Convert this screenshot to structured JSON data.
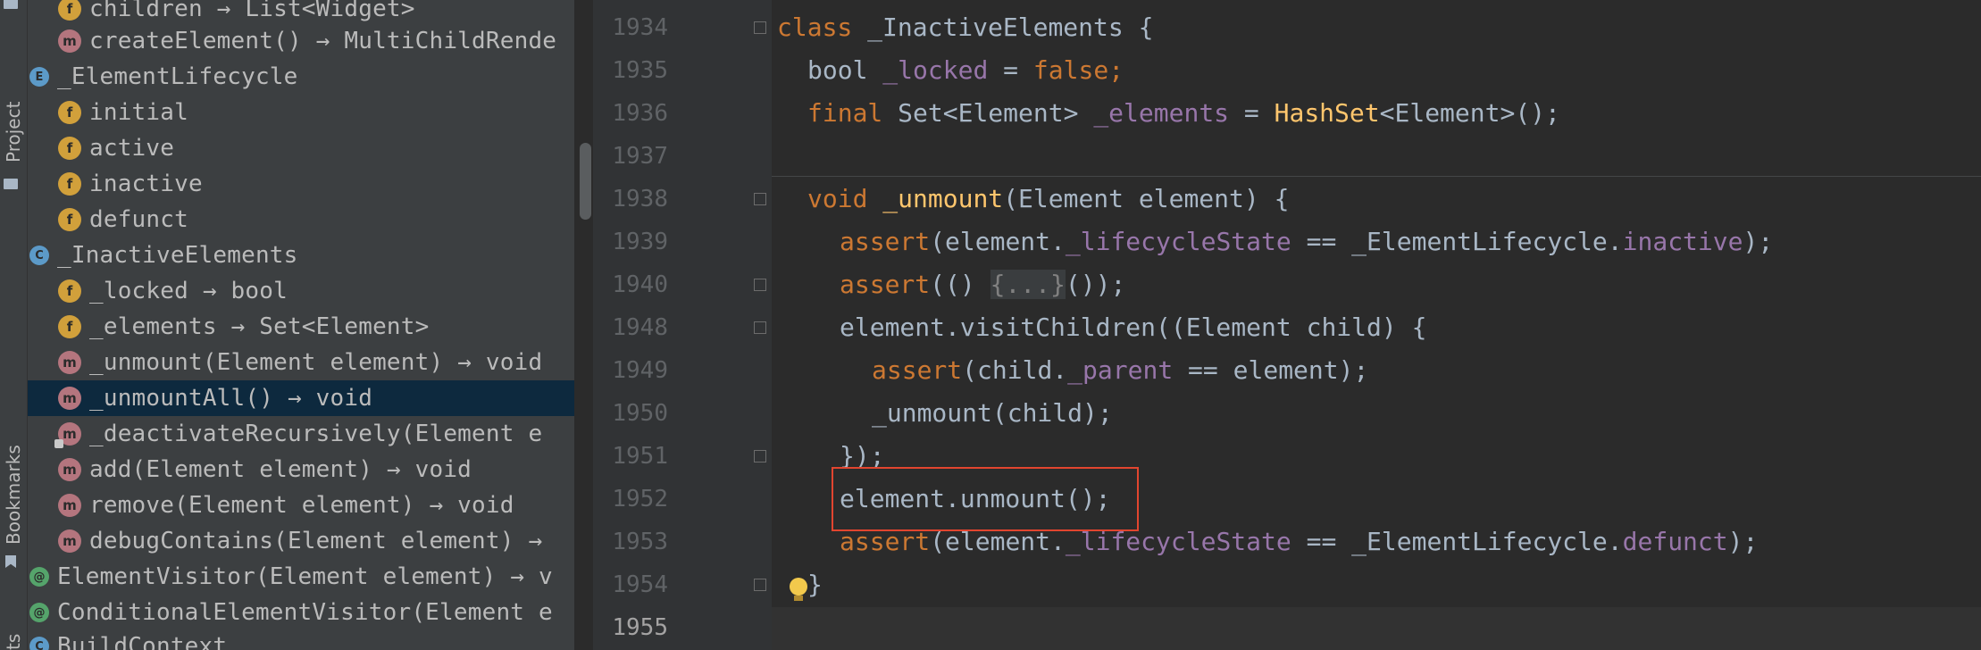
{
  "sidebar": {
    "project_label": "Project",
    "bookmarks_label": "Bookmarks",
    "bottom_label": "ts"
  },
  "structure": {
    "items": [
      {
        "badge": "f",
        "label": "children → List<Widget>"
      },
      {
        "badge": "m",
        "label": "createElement() → MultiChildRende"
      },
      {
        "badge": "e",
        "label": "_ElementLifecycle"
      },
      {
        "badge": "f",
        "label": "initial"
      },
      {
        "badge": "f",
        "label": "active"
      },
      {
        "badge": "f",
        "label": "inactive"
      },
      {
        "badge": "f",
        "label": "defunct"
      },
      {
        "badge": "c",
        "label": "_InactiveElements"
      },
      {
        "badge": "f",
        "label": "_locked → bool"
      },
      {
        "badge": "f",
        "label": "_elements → Set<Element>"
      },
      {
        "badge": "m",
        "label": "_unmount(Element element) → void"
      },
      {
        "badge": "m",
        "label": "_unmountAll() → void"
      },
      {
        "badge": "m",
        "label": "_deactivateRecursively(Element e"
      },
      {
        "badge": "m",
        "label": "add(Element element) → void"
      },
      {
        "badge": "m",
        "label": "remove(Element element) → void"
      },
      {
        "badge": "m",
        "label": "debugContains(Element element) →"
      },
      {
        "badge": "@",
        "label": "ElementVisitor(Element element) → v"
      },
      {
        "badge": "@",
        "label": "ConditionalElementVisitor(Element e"
      },
      {
        "badge": "c",
        "label": "BuildContext"
      }
    ]
  },
  "editor": {
    "line_numbers": [
      "1934",
      "1935",
      "1936",
      "1937",
      "1938",
      "1939",
      "1940",
      "1948",
      "1949",
      "1950",
      "1951",
      "1952",
      "1953",
      "1954",
      "1955"
    ],
    "lines": [
      {
        "kind": "class_decl",
        "t": [
          "class ",
          "_InactiveElements {"
        ]
      },
      {
        "kind": "field",
        "t": [
          "bool ",
          "_locked",
          " = ",
          "false",
          ";"
        ]
      },
      {
        "kind": "field2",
        "t": [
          "final ",
          "Set<Element> ",
          "_elements",
          " = ",
          "HashSet",
          "<Element>();"
        ]
      },
      {
        "kind": "blank",
        "t": []
      },
      {
        "kind": "method",
        "t": [
          "void ",
          "_unmount",
          "(Element element) {"
        ]
      },
      {
        "kind": "assert1",
        "t": [
          "assert",
          "(element.",
          "_lifecycleState",
          " == _ElementLifecycle.",
          "inactive",
          ");"
        ]
      },
      {
        "kind": "assert2",
        "t": [
          "assert",
          "(() ",
          "{...}",
          "());"
        ]
      },
      {
        "kind": "visit",
        "t": [
          "element.visitChildren((Element child) {"
        ]
      },
      {
        "kind": "assert3",
        "t": [
          "assert",
          "(child.",
          "_parent",
          " == element);"
        ]
      },
      {
        "kind": "call",
        "t": [
          "_unmount(child);"
        ]
      },
      {
        "kind": "close",
        "t": [
          "});"
        ]
      },
      {
        "kind": "unmount",
        "t": [
          "element.unmount();"
        ]
      },
      {
        "kind": "assert4",
        "t": [
          "assert",
          "(element.",
          "_lifecycleState",
          " == _ElementLifecycle.",
          "defunct",
          ");"
        ]
      },
      {
        "kind": "brace",
        "t": [
          "}"
        ]
      },
      {
        "kind": "blank",
        "t": []
      }
    ]
  }
}
